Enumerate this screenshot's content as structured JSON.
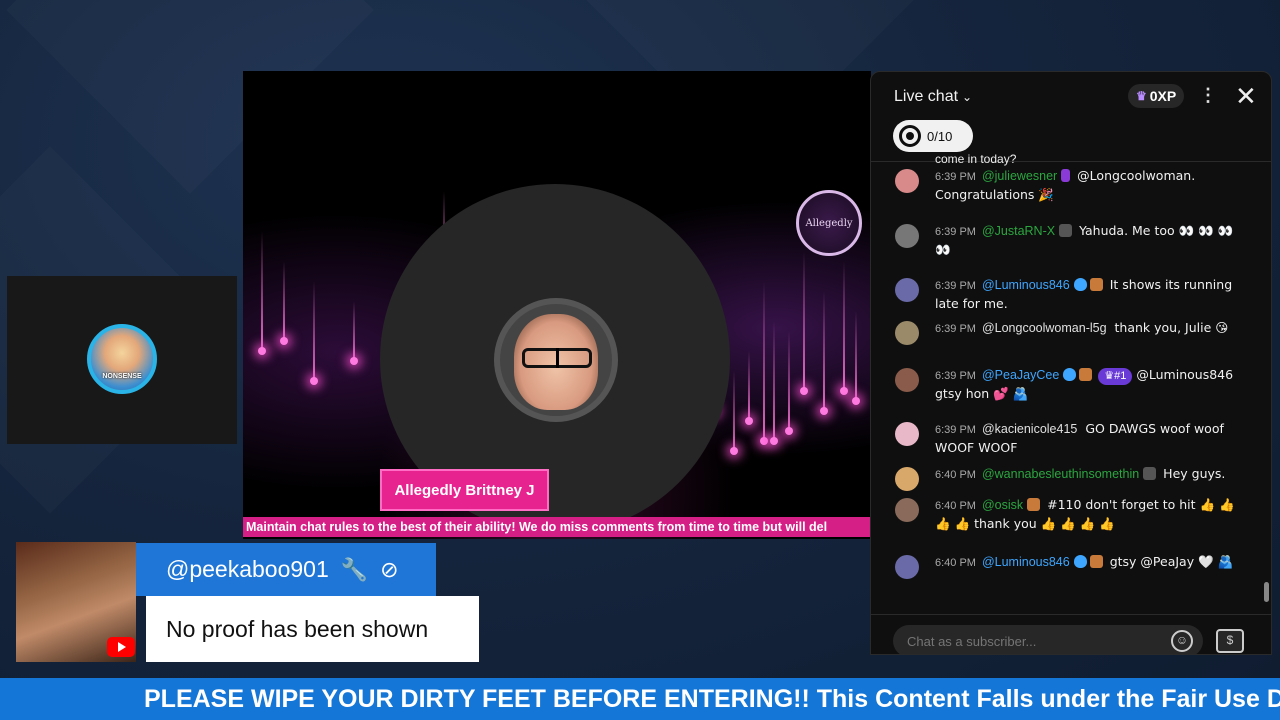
{
  "stream": {
    "streamer_name": "Allegedly Brittney J",
    "rules_banner": "Maintain chat rules to the best of their ability! We do miss comments from time to time but will del",
    "logo_text": "Allegedly",
    "accent_color": "#e7238f"
  },
  "host_panel": {
    "logo_text": "NONSENSE"
  },
  "comment_overlay": {
    "username": "@peekaboo901",
    "text": "No proof has been shown",
    "username_bg": "#1f76d6"
  },
  "chat": {
    "title": "Live chat",
    "xp": "0XP",
    "goal": "0/10",
    "cutoff_text": "come in today?",
    "input_placeholder": "Chat as a subscriber...",
    "messages": [
      {
        "time": "6:39 PM",
        "author": "@juliewesner",
        "text": "@Longcoolwoman. Congratulations 🎉",
        "avatar_color": "#d88a8a",
        "author_type": "green"
      },
      {
        "time": "6:39 PM",
        "author": "@JustaRN-X",
        "text": "Yahuda. Me too 👀 👀 👀 👀",
        "avatar_color": "#777",
        "author_type": "green"
      },
      {
        "time": "6:39 PM",
        "author": "@Luminous846",
        "text": "It shows its running late for me.",
        "avatar_color": "#6a6aa8",
        "author_type": "member"
      },
      {
        "time": "6:39 PM",
        "author": "@Longcoolwoman-l5g",
        "text": "thank you, Julie 😘",
        "avatar_color": "#9a8a6a",
        "author_type": "plain"
      },
      {
        "time": "6:39 PM",
        "author": "@PeaJayCee",
        "rank": "#1",
        "text": "@Luminous846 gtsy hon 💕 🫂",
        "avatar_color": "#8a5a4a",
        "author_type": "member"
      },
      {
        "time": "6:39 PM",
        "author": "@kacienicole415",
        "text": "GO DAWGS woof woof WOOF WOOF",
        "avatar_color": "#e8b8c8",
        "author_type": "plain"
      },
      {
        "time": "6:40 PM",
        "author": "@wannabesleuthinsomethin",
        "text": "Hey guys.",
        "avatar_color": "#d8a86a",
        "author_type": "green"
      },
      {
        "time": "6:40 PM",
        "author": "@osisk",
        "text": "#110 don't forget to hit 👍 👍 👍 👍 thank you 👍 👍 👍 👍",
        "avatar_color": "#8a6a5a",
        "author_type": "green"
      },
      {
        "time": "6:40 PM",
        "author": "@Luminous846",
        "text": "gtsy @PeaJay 🤍 🫂",
        "avatar_color": "#6a6aa8",
        "author_type": "member"
      }
    ]
  },
  "ticker": {
    "text": "PLEASE WIPE YOUR DIRTY FEET BEFORE ENTERING!! This Content Falls under the Fair Use Di"
  },
  "icons": [
    "wrench-icon",
    "block-icon",
    "chevron-down-icon",
    "crown-icon",
    "kebab-menu-icon",
    "close-icon",
    "target-icon",
    "smile-icon",
    "super-chat-icon",
    "youtube-icon"
  ]
}
